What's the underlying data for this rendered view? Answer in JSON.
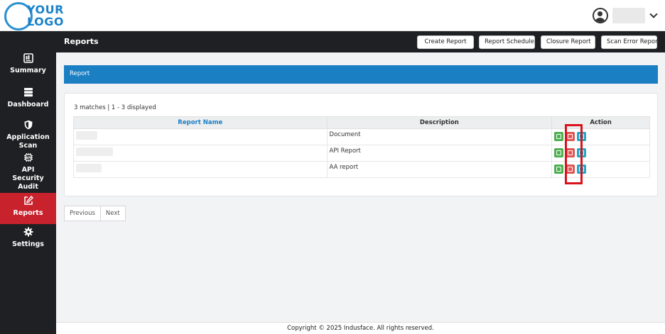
{
  "logo": {
    "line1": "YOUR",
    "line2": "LOGO"
  },
  "header": {
    "user_icon": "user-circle-icon",
    "chevron_icon": "chevron-down-icon"
  },
  "sidebar": {
    "items": [
      {
        "label": "Summary",
        "icon": "summary-icon"
      },
      {
        "label": "Dashboard",
        "icon": "dashboard-icon"
      },
      {
        "label": "Application Scan",
        "icon": "shield-icon"
      },
      {
        "label": "API Security Audit",
        "icon": "api-icon"
      },
      {
        "label": "Reports",
        "icon": "edit-icon",
        "active": true
      },
      {
        "label": "Settings",
        "icon": "gear-icon"
      }
    ]
  },
  "page": {
    "title": "Reports",
    "buttons": {
      "create": "Create Report",
      "schedule": "Report Schedule",
      "closure": "Closure Report",
      "scan_error": "Scan Error Report"
    }
  },
  "panel": {
    "title": "Report"
  },
  "table": {
    "matches": "3 matches | 1 - 3 displayed",
    "headers": {
      "name": "Report Name",
      "description": "Description",
      "action": "Action"
    },
    "rows": [
      {
        "name": "",
        "description": "Document"
      },
      {
        "name": "",
        "description": "API Report"
      },
      {
        "name": "",
        "description": "AA report"
      }
    ]
  },
  "pagination": {
    "previous": "Previous",
    "next": "Next"
  },
  "footer": {
    "text": "Copyright © 2025 Indusface. All rights reserved."
  },
  "colors": {
    "accent": "#1b7fc4",
    "active": "#c8222d",
    "sidebar": "#1e2023",
    "edit": "#4caf50",
    "delete": "#e05454",
    "view": "#1fa8c9"
  }
}
